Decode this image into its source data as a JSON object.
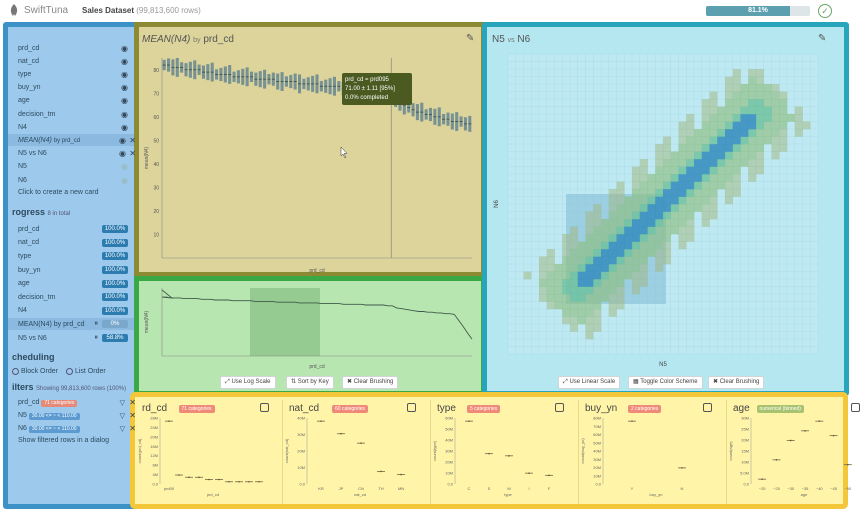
{
  "app": {
    "name": "SwiftTuna",
    "dataset_label": "Sales Dataset",
    "dataset_rows": "(99,813,600 rows)"
  },
  "top_progress": {
    "text": "81.1%",
    "value": 81.1
  },
  "sidebar": {
    "cards": [
      {
        "label": "prd_cd",
        "state": "eye"
      },
      {
        "label": "nat_cd",
        "state": "eye"
      },
      {
        "label": "type",
        "state": "eye"
      },
      {
        "label": "buy_yn",
        "state": "eye"
      },
      {
        "label": "age",
        "state": "eye"
      },
      {
        "label": "decision_tm",
        "state": "eye"
      },
      {
        "label": "N4",
        "state": "eye"
      },
      {
        "label": "MEAN(N4) by prd_cd",
        "state": "eye-x",
        "highlight": true,
        "italic_prefix": "MEAN(N4)",
        "suffix": "by prd_cd"
      },
      {
        "label": "N5 vs N6",
        "state": "eye-x"
      },
      {
        "label": "N5",
        "state": "dim"
      },
      {
        "label": "N6",
        "state": "dim"
      }
    ],
    "create_card": "Click to create a new card",
    "progress_title": "rogress",
    "progress_sub": "8 in total",
    "progress_items": [
      {
        "label": "prd_cd",
        "value": "100.0%"
      },
      {
        "label": "nat_cd",
        "value": "100.0%"
      },
      {
        "label": "type",
        "value": "100.0%"
      },
      {
        "label": "buy_yn",
        "value": "100.0%"
      },
      {
        "label": "age",
        "value": "100.0%"
      },
      {
        "label": "decision_tm",
        "value": "100.0%"
      },
      {
        "label": "N4",
        "value": "100.0%"
      },
      {
        "label": "MEAN(N4) by prd_cd",
        "value": "0%",
        "highlight": true
      },
      {
        "label": "N5 vs N6",
        "value": "58.8%"
      }
    ],
    "scheduling_title": "cheduling",
    "sched_options": [
      "Block Order",
      "List Order"
    ],
    "filters_title": "ilters",
    "filters_sub": "Showing 99,813,600 rows (100%)",
    "filters": [
      {
        "label": "prd_cd",
        "badge": "71 categories"
      },
      {
        "label": "N5",
        "badge": "30.00 <= ~ < 110.00"
      },
      {
        "label": "N6",
        "badge": "30.00 <= ~ < 110.00"
      }
    ],
    "show_filtered": "Show filtered rows in a dialog"
  },
  "main_card": {
    "title_italic": "MEAN(N4)",
    "title_by": "by",
    "title_var": "prd_cd",
    "ylabel": "mean(N4)",
    "xlabel": "prd_cd",
    "y_ticks": [
      "80",
      "70",
      "60",
      "50",
      "40",
      "30",
      "20",
      "10"
    ],
    "tooltip": {
      "line1": "prd_cd = prd095",
      "line2": "71.00 ± 1.11 [95%]",
      "line3": "0.0% completed"
    }
  },
  "spark": {
    "xlabel": "prd_cd",
    "ylabel": "mean(N4)"
  },
  "main_buttons": [
    "Use Log Scale",
    "Sort by Key",
    "Clear Brushing"
  ],
  "heat_card": {
    "title_a": "N5",
    "title_vs": "vs",
    "title_b": "N6",
    "xlabel": "N5",
    "ylabel": "N6"
  },
  "heat_buttons": [
    "Use Linear Scale",
    "Toggle Color Scheme",
    "Clear Brushing"
  ],
  "bottom_cards": [
    {
      "title": "rd_cd",
      "badge": "71 categories",
      "ylabel": "count(prd_cd)",
      "xlabel": "prd_cd",
      "xticks": [
        "prd00"
      ],
      "yticks": [
        "28M",
        "24M",
        "20M",
        "16M",
        "12M",
        "8M",
        "4M",
        "0.0"
      ]
    },
    {
      "title": "nat_cd",
      "badge": "60 categories",
      "ylabel": "count(nat_cd)",
      "xlabel": "nat_cd",
      "xticks": [
        "KR",
        "JP",
        "CN",
        "TH",
        "MN"
      ],
      "yticks": [
        "40M",
        "30M",
        "20M",
        "10M",
        "0.0"
      ]
    },
    {
      "title": "type",
      "badge": "5 categories",
      "ylabel": "count(type)",
      "xlabel": "type",
      "xticks": [
        "C",
        "S",
        "M",
        "I",
        "F"
      ],
      "yticks": [
        "60M",
        "50M",
        "40M",
        "30M",
        "20M",
        "10M",
        "0.0"
      ]
    },
    {
      "title": "buy_yn",
      "badge": "2 categories",
      "ylabel": "count(buy_yn)",
      "xlabel": "buy_yn",
      "xticks": [
        "Y",
        "N"
      ],
      "yticks": [
        "80M",
        "70M",
        "60M",
        "50M",
        "40M",
        "30M",
        "20M",
        "10M",
        "0.0"
      ]
    },
    {
      "title": "age",
      "badge": "numerical (binned)",
      "ylabel": "count(age)",
      "xlabel": "age",
      "xticks": [
        "~20",
        "~25",
        "~30",
        "~35",
        "~40",
        "~45",
        "~50"
      ],
      "yticks": [
        "30M",
        "25M",
        "20M",
        "15M",
        "10M",
        "5.0M",
        "0.0"
      ]
    }
  ],
  "chart_data": [
    {
      "type": "scatter",
      "title": "MEAN(N4) by prd_cd",
      "xlabel": "prd_cd",
      "ylabel": "mean(N4)",
      "ylim": [
        0,
        85
      ],
      "note": "71 categories sorted by mean descending",
      "values": [
        82,
        82,
        81,
        81,
        81,
        80,
        80,
        80,
        80,
        79,
        79,
        79,
        78,
        78,
        78,
        78,
        77,
        77,
        77,
        77,
        77,
        76,
        76,
        76,
        76,
        76,
        75,
        75,
        75,
        75,
        75,
        74,
        74,
        74,
        74,
        74,
        73,
        73,
        73,
        73,
        73,
        72,
        72,
        72,
        72,
        72,
        71,
        71,
        71,
        71,
        71,
        70,
        70,
        67,
        66,
        65,
        64,
        63,
        62,
        62,
        61,
        61,
        60,
        60,
        59,
        59,
        58,
        58,
        58,
        57,
        57
      ]
    },
    {
      "type": "bar",
      "title": "prd_cd",
      "ylabel": "count(prd_cd)",
      "values": [
        28,
        4,
        3,
        3,
        2,
        2,
        1,
        1,
        1,
        1
      ]
    },
    {
      "type": "bar",
      "title": "nat_cd",
      "ylabel": "count(nat_cd)",
      "categories": [
        "KR",
        "JP",
        "CN",
        "TH",
        "MN"
      ],
      "values": [
        40,
        32,
        26,
        8,
        6
      ]
    },
    {
      "type": "bar",
      "title": "type",
      "ylabel": "count(type)",
      "categories": [
        "C",
        "S",
        "M",
        "I",
        "F"
      ],
      "values": [
        58,
        28,
        26,
        10,
        8
      ]
    },
    {
      "type": "bar",
      "title": "buy_yn",
      "ylabel": "count(buy_yn)",
      "categories": [
        "Y",
        "N"
      ],
      "values": [
        78,
        20
      ]
    },
    {
      "type": "bar",
      "title": "age",
      "ylabel": "count(age)",
      "categories": [
        "~20",
        "~25",
        "~30",
        "~35",
        "~40",
        "~45",
        "~50"
      ],
      "values": [
        2,
        10,
        18,
        22,
        26,
        20,
        8
      ]
    }
  ],
  "colors": {
    "side_fill": "#9cc9ec",
    "side_border": "#3c91c7",
    "main_fill": "#dcd49b",
    "main_border": "#8c8a32",
    "spark_fill": "#b8e6b0",
    "spark_border": "#3aa845",
    "heat_fill": "#b5e7f0",
    "heat_border": "#27a5bd",
    "bottom_fill": "#fff4a8",
    "bottom_border": "#f4c63a",
    "accent": "#2d7cb0"
  }
}
